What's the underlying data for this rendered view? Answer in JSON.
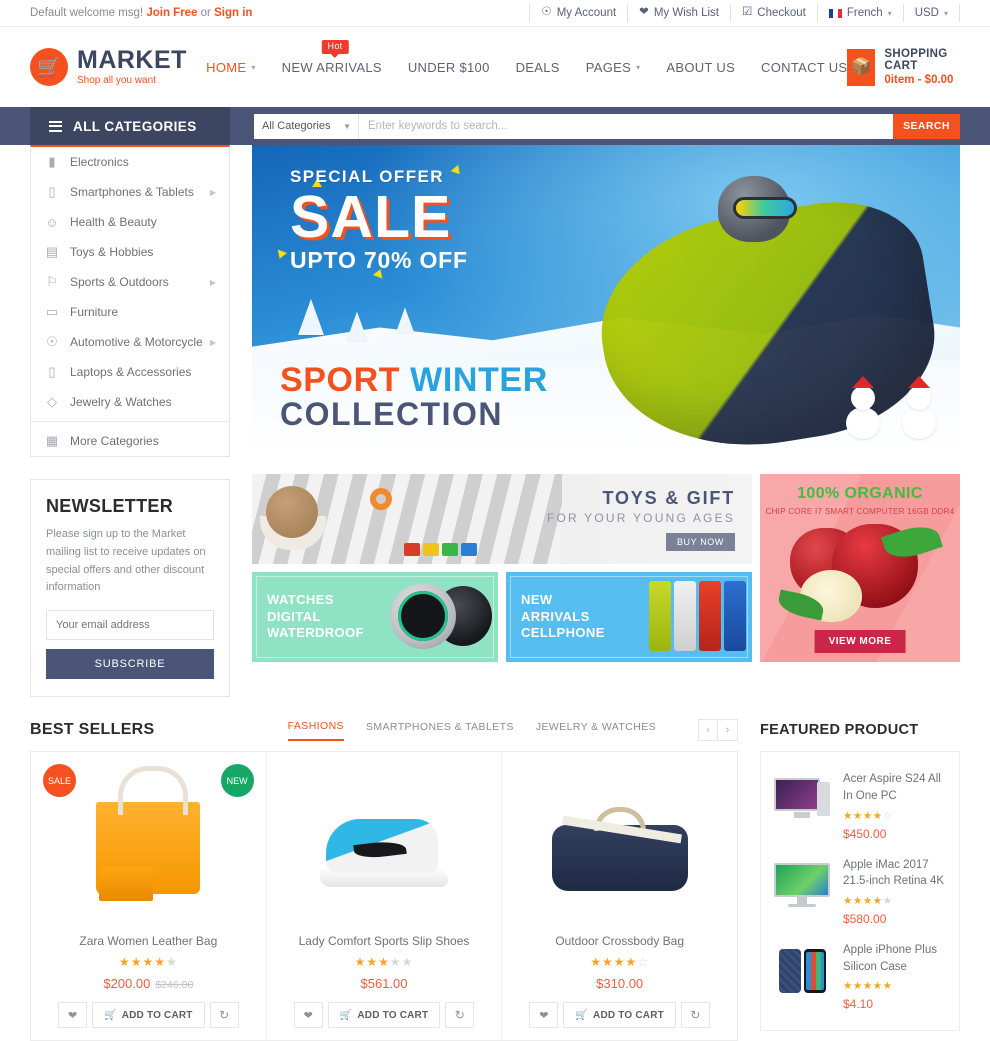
{
  "topbar": {
    "welcome_prefix": "Default welcome msg!",
    "join_free": "Join Free",
    "or": " or ",
    "sign_in": "Sign in",
    "links": [
      {
        "label": "My Account",
        "icon": "user-circle-icon"
      },
      {
        "label": "My Wish List",
        "icon": "heart-icon"
      },
      {
        "label": "Checkout",
        "icon": "check-square-icon"
      },
      {
        "label": "French",
        "icon": "french-flag-icon"
      },
      {
        "label": "USD",
        "icon": "caret-down-icon"
      }
    ]
  },
  "header": {
    "logo": {
      "brand": "MARKET",
      "tagline": "Shop all you want",
      "icon": "shopping-cart-icon"
    },
    "nav": [
      {
        "label": "HOME",
        "active": true,
        "caret": true,
        "badge": null
      },
      {
        "label": "NEW ARRIVALS",
        "active": false,
        "caret": false,
        "badge": "Hot"
      },
      {
        "label": "UNDER $100",
        "active": false,
        "caret": false,
        "badge": null
      },
      {
        "label": "DEALS",
        "active": false,
        "caret": false,
        "badge": null
      },
      {
        "label": "PAGES",
        "active": false,
        "caret": true,
        "badge": null
      },
      {
        "label": "ABOUT US",
        "active": false,
        "caret": false,
        "badge": null
      },
      {
        "label": "CONTACT US",
        "active": false,
        "caret": false,
        "badge": null
      }
    ],
    "cart": {
      "title": "SHOPPING CART",
      "summary": "0item - $0.00",
      "icon": "basket-icon"
    }
  },
  "search": {
    "all_categories_label": "ALL CATEGORIES",
    "select_value": "All Categories",
    "placeholder": "Enter keywords to search...",
    "button": "SEARCH"
  },
  "categories": [
    {
      "label": "Electronics",
      "icon": "device-icon",
      "has_sub": false
    },
    {
      "label": "Smartphones & Tablets",
      "icon": "smartphone-icon",
      "has_sub": true
    },
    {
      "label": "Health & Beauty",
      "icon": "bottle-icon",
      "has_sub": false
    },
    {
      "label": "Toys & Hobbies",
      "icon": "train-icon",
      "has_sub": false
    },
    {
      "label": "Sports & Outdoors",
      "icon": "skier-icon",
      "has_sub": true
    },
    {
      "label": "Furniture",
      "icon": "sofa-icon",
      "has_sub": false
    },
    {
      "label": "Automotive & Motorcycle",
      "icon": "car-icon",
      "has_sub": true
    },
    {
      "label": "Laptops & Accessories",
      "icon": "laptop-icon",
      "has_sub": false
    },
    {
      "label": "Jewelry & Watches",
      "icon": "gem-icon",
      "has_sub": false
    }
  ],
  "more_categories": {
    "label": "More Categories",
    "icon": "grid-icon"
  },
  "hero": {
    "special_offer": "SPECIAL OFFER",
    "sale": "SALE",
    "upto": "UPTO 70% OFF",
    "sport": "SPORT",
    "winter": "WINTER",
    "collection": "COLLECTION"
  },
  "newsletter": {
    "title": "NEWSLETTER",
    "text": "Please sign up to the Market mailing list to receive updates on special offers and other discount information",
    "placeholder": "Your email address",
    "button": "SUBSCRIBE"
  },
  "promos": {
    "toys": {
      "title": "TOYS & GIFT",
      "subtitle": "FOR YOUR YOUNG AGES",
      "button": "BUY NOW"
    },
    "watches": {
      "line1": "WATCHES",
      "line2": "DIGITAL",
      "line3": "WATERDROOF"
    },
    "cellphone": {
      "line1": "NEW",
      "line2": "ARRIVALS",
      "line3": "CELLPHONE"
    },
    "organic": {
      "title": "100% ORGANIC",
      "subtitle": "CHIP CORE I7 SMART COMPUTER 16GB DDR4",
      "button": "VIEW MORE"
    }
  },
  "bestsellers": {
    "title": "BEST SELLERS",
    "tabs": [
      {
        "label": "FASHIONS",
        "active": true
      },
      {
        "label": "SMARTPHONES & TABLETS",
        "active": false
      },
      {
        "label": "JEWELRY & WATCHES",
        "active": false
      }
    ],
    "prev": "‹",
    "next": "›",
    "products": [
      {
        "name": "Zara Women Leather Bag",
        "price": "$200.00",
        "old_price": "$246.00",
        "rating": 4,
        "badges": [
          "SALE",
          "NEW"
        ],
        "add_to_cart": "ADD TO CART",
        "wishlist_icon": "heart-icon",
        "compare_icon": "refresh-icon"
      },
      {
        "name": "Lady Comfort Sports Slip Shoes",
        "price": "$561.00",
        "old_price": "",
        "rating": 3,
        "badges": [],
        "add_to_cart": "ADD TO CART",
        "wishlist_icon": "heart-icon",
        "compare_icon": "refresh-icon"
      },
      {
        "name": "Outdoor Crossbody Bag",
        "price": "$310.00",
        "old_price": "",
        "rating": 4.5,
        "badges": [],
        "add_to_cart": "ADD TO CART",
        "wishlist_icon": "heart-icon",
        "compare_icon": "refresh-icon"
      }
    ]
  },
  "featured": {
    "title": "FEATURED PRODUCT",
    "items": [
      {
        "name": "Acer Aspire S24 All In One PC",
        "rating": 4.5,
        "price": "$450.00",
        "image": "desktop-pc-image"
      },
      {
        "name": "Apple iMac 2017 21.5-inch Retina 4K",
        "rating": 4,
        "price": "$580.00",
        "image": "imac-image"
      },
      {
        "name": "Apple iPhone Plus Silicon Case",
        "rating": 5,
        "price": "$4.10",
        "image": "iphone-case-image"
      }
    ]
  },
  "colors": {
    "accent_orange": "#f4511e",
    "dark_blue": "#4a5578",
    "darker_blue": "#3d4660",
    "price_red": "#f25c41",
    "star_gold": "#f5a623",
    "new_green": "#16a765"
  }
}
